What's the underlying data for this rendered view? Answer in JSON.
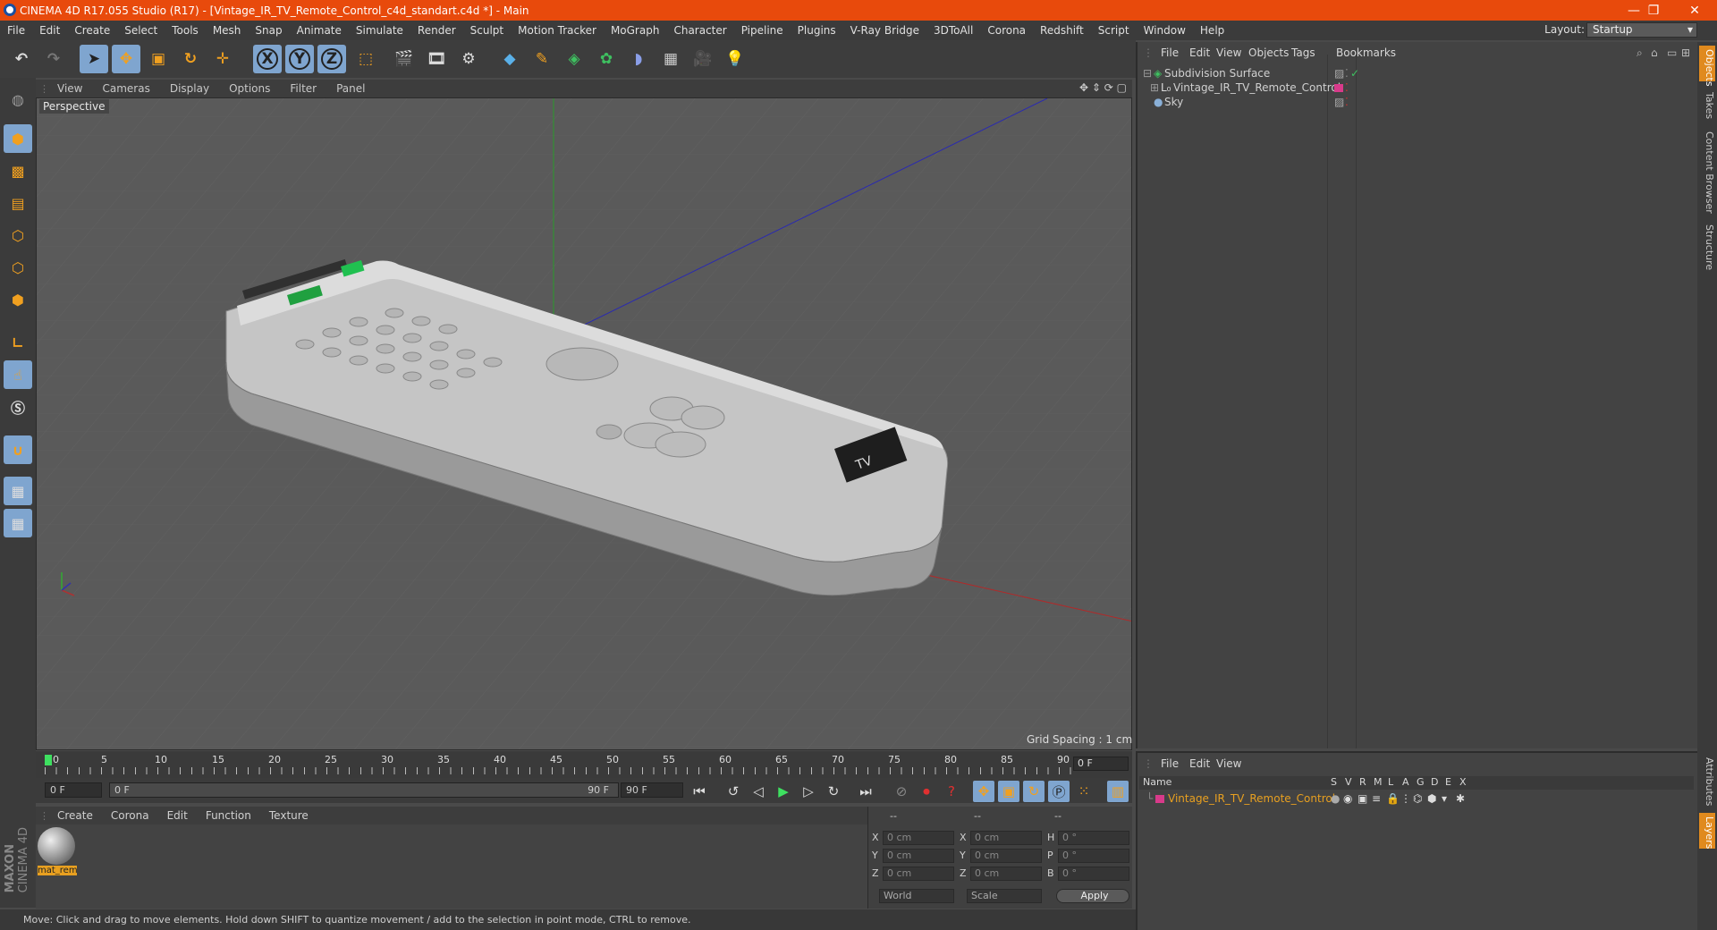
{
  "app": {
    "title": "CINEMA 4D R17.055 Studio (R17) - [Vintage_IR_TV_Remote_Control_c4d_standart.c4d *] - Main",
    "icon": "cinema4d-logo-icon"
  },
  "window_controls": {
    "minimize": "—",
    "restore": "❐",
    "close": "✕"
  },
  "menubar": {
    "items": [
      "File",
      "Edit",
      "Create",
      "Select",
      "Tools",
      "Mesh",
      "Snap",
      "Animate",
      "Simulate",
      "Render",
      "Sculpt",
      "Motion Tracker",
      "MoGraph",
      "Character",
      "Pipeline",
      "Plugins",
      "V-Ray Bridge",
      "3DToAll",
      "Corona",
      "Redshift",
      "Script",
      "Window",
      "Help"
    ],
    "layout_label": "Layout:",
    "layout_value": "Startup"
  },
  "toolbar": {
    "axis_x": "X",
    "axis_y": "Y",
    "axis_z": "Z",
    "icons": [
      "undo-icon",
      "redo-icon",
      "select-arrow-icon",
      "move-icon",
      "scale-icon",
      "rotate-icon",
      "last-tool-icon",
      "axis-x-icon",
      "axis-y-icon",
      "axis-z-icon",
      "coordinate-system-icon",
      "render-view-icon",
      "render-picture-viewer-icon",
      "render-settings-icon",
      "cube-icon",
      "pen-spline-icon",
      "subdivision-icon",
      "array-icon",
      "deformer-icon",
      "floor-icon",
      "camera-icon",
      "light-icon"
    ]
  },
  "viewport": {
    "menu": [
      "View",
      "Cameras",
      "Display",
      "Options",
      "Filter",
      "Panel"
    ],
    "label": "Perspective",
    "grid_spacing": "Grid Spacing : 1 cm",
    "remote_label": "TV"
  },
  "timeline": {
    "ticks": [
      "0",
      "5",
      "10",
      "15",
      "20",
      "25",
      "30",
      "35",
      "40",
      "45",
      "50",
      "55",
      "60",
      "65",
      "70",
      "75",
      "80",
      "85",
      "90"
    ],
    "current_frame": "0 F"
  },
  "transport": {
    "start_field": "0 F",
    "range_start": "0 F",
    "range_end": "90 F",
    "end_field": "90 F"
  },
  "material_manager": {
    "menu": [
      "Create",
      "Corona",
      "Edit",
      "Function",
      "Texture"
    ],
    "material_name": "mat_rem"
  },
  "coordinates": {
    "header": [
      "--",
      "--",
      "--"
    ],
    "rows": [
      {
        "a": "X",
        "av": "0 cm",
        "b": "X",
        "bv": "0 cm",
        "c": "H",
        "cv": "0 °"
      },
      {
        "a": "Y",
        "av": "0 cm",
        "b": "Y",
        "bv": "0 cm",
        "c": "P",
        "cv": "0 °"
      },
      {
        "a": "Z",
        "av": "0 cm",
        "b": "Z",
        "bv": "0 cm",
        "c": "B",
        "cv": "0 °"
      }
    ],
    "mode_world": "World",
    "mode_scale": "Scale",
    "apply": "Apply"
  },
  "status": "Move: Click and drag to move elements. Hold down SHIFT to quantize movement / add to the selection in point mode, CTRL to remove.",
  "object_manager": {
    "menu": [
      "File",
      "Edit",
      "View",
      "Objects",
      "Tags",
      "Bookmarks"
    ],
    "objects": [
      {
        "name": "Subdivision Surface",
        "color": "#d0d0d0"
      },
      {
        "name": "Vintage_IR_TV_Remote_Control",
        "color": "#d0d0d0"
      },
      {
        "name": "Sky",
        "color": "#d0d0d0"
      }
    ]
  },
  "layer_manager": {
    "menu": [
      "File",
      "Edit",
      "View"
    ],
    "columns": [
      "Name",
      "S",
      "V",
      "R",
      "M",
      "L",
      "A",
      "G",
      "D",
      "E",
      "X"
    ],
    "layers": [
      {
        "name": "Vintage_IR_TV_Remote_Control",
        "color": "#e8a020"
      }
    ]
  },
  "right_tabs": [
    "Objects",
    "Takes",
    "Content Browser",
    "Structure",
    "Attributes",
    "Layers"
  ],
  "colors": {
    "accent": "#e84a0c",
    "selected": "#7fa5cf",
    "layer_pink": "#d83a8a",
    "highlight": "#e08a1e"
  }
}
